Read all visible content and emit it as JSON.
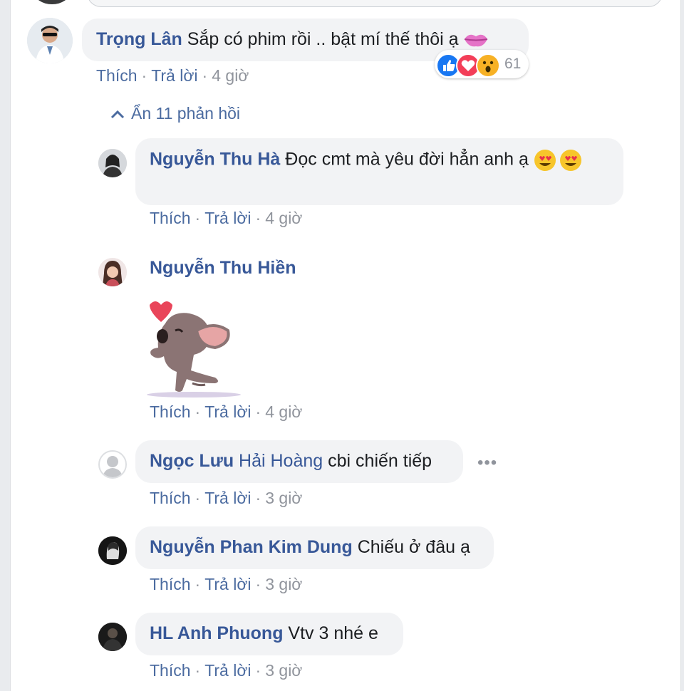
{
  "comments": [
    {
      "author": "Trọng Lân",
      "text": "Sắp có phim rồi .. bật mí thế thôi ạ",
      "like_label": "Thích",
      "reply_label": "Trả lời",
      "time": "4 giờ",
      "reactions": {
        "count": "61",
        "icons": [
          "like-icon",
          "love-icon",
          "wow-icon"
        ]
      },
      "toggle_replies": "Ẩn 11 phản hồi"
    }
  ],
  "replies": [
    {
      "author": "Nguyễn Thu Hà",
      "text": "Đọc cmt mà yêu đời hẳn anh ạ",
      "like_label": "Thích",
      "reply_label": "Trả lời",
      "time": "4 giờ"
    },
    {
      "author": "Nguyễn Thu Hiền",
      "sticker": "dog-blowing-kiss-sticker",
      "like_label": "Thích",
      "reply_label": "Trả lời",
      "time": "4 giờ"
    },
    {
      "author_first": "Ngọc Lưu",
      "author_tag": "Hải Hoàng",
      "text": "cbi chiến tiếp",
      "like_label": "Thích",
      "reply_label": "Trả lời",
      "time": "3 giờ"
    },
    {
      "author": "Nguyễn Phan Kim Dung",
      "text": "Chiếu ở đâu ạ",
      "like_label": "Thích",
      "reply_label": "Trả lời",
      "time": "3 giờ"
    },
    {
      "author": "HL Anh Phuong",
      "text": "Vtv 3 nhé e",
      "like_label": "Thích",
      "reply_label": "Trả lời",
      "time": "3 giờ"
    }
  ],
  "colors": {
    "name": "#385898",
    "bubble": "#f2f3f5",
    "meta": "#90949c",
    "like": "#1877f2",
    "love": "#f33e58",
    "wow": "#f7b125"
  }
}
